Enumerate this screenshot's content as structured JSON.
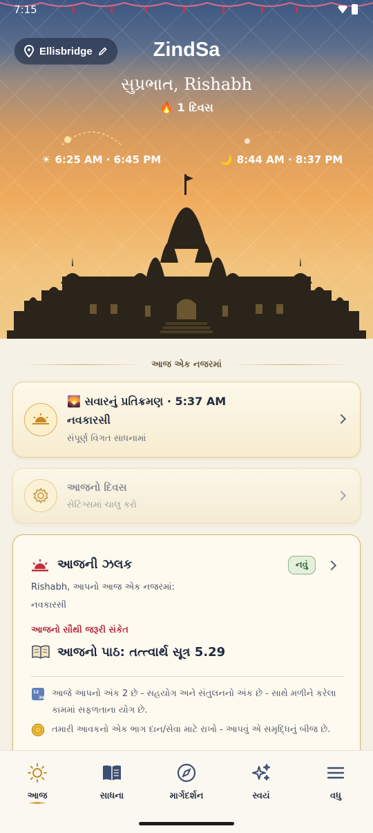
{
  "status_bar": {
    "time": "7:15"
  },
  "header": {
    "location": "Ellisbridge",
    "app_name": "ZindSa",
    "greeting": "સુપ્રભાત, Rishabh",
    "streak": "1 દિવસ",
    "sun_times": "6:25 AM · 6:45 PM",
    "moon_times": "8:44 AM · 8:37 PM"
  },
  "section_title": "આજ એક નજરમાં",
  "cards": {
    "pratikraman": {
      "title": "🌄 સવારનું પ્રતિક્રમણ · 5:37 AM",
      "subtitle": "નવકારસી",
      "description": "સંપૂર્ણ વિગત સાધનામાં"
    },
    "today": {
      "title": "આજનો દિવસ",
      "description": "સેટિંગ્સમાં ચાલુ કરો"
    },
    "glimpse": {
      "title": "આજની ઝલક",
      "badge": "નવું",
      "line1": "Rishabh, આપનો આજ એક નજરમાં:",
      "line2": "નવકારસી",
      "important_label": "આજનો સૌથી જરૂરી સંકેત",
      "lesson": "આજનો પાઠ: તત્ત્વાર્થ સૂત્ર 5.29",
      "tips": [
        {
          "icon": "numbers-icon",
          "text": "આજે આપનો અંક 2 છે - સહયોગ અને સંતુલનનો અંક છે - સાથે મળીને કરેલા કામમાં સફળતાના યોગ છે."
        },
        {
          "icon": "coin-icon",
          "text": "તમારી આવકનો એક ભાગ દાન/સેવા માટે રાખો - આપવું એ સમૃદ્ધિનું બીજ છે."
        }
      ]
    }
  },
  "bottom_nav": [
    {
      "icon": "sun-icon",
      "label": "આજ",
      "active": true
    },
    {
      "icon": "book-icon",
      "label": "સાધના",
      "active": false
    },
    {
      "icon": "compass-icon",
      "label": "માર્ગદર્શન",
      "active": false
    },
    {
      "icon": "sparkles-icon",
      "label": "સ્વયં",
      "active": false
    },
    {
      "icon": "menu-icon",
      "label": "વધુ",
      "active": false
    }
  ],
  "colors": {
    "accent_gold": "#d89a2c",
    "important_red": "#b2283a",
    "badge_green": "#2f6b35"
  }
}
